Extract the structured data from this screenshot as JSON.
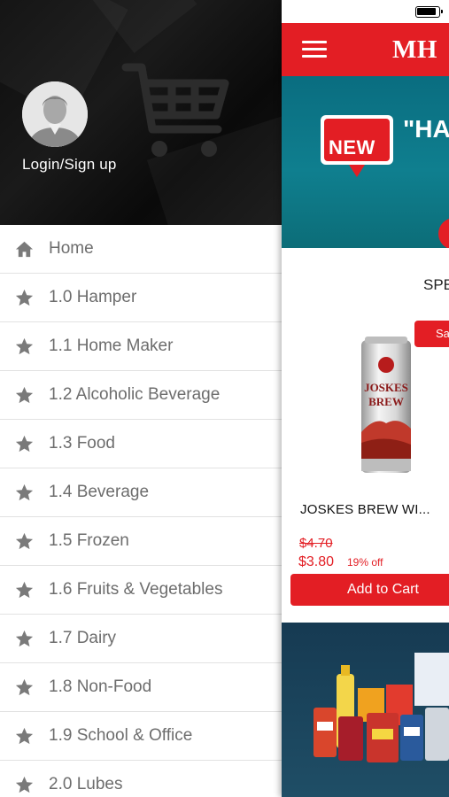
{
  "drawer": {
    "login_label": "Login/Sign up",
    "items": [
      {
        "label": "Home",
        "icon": "home-icon"
      },
      {
        "label": "1.0 Hamper",
        "icon": "star-icon"
      },
      {
        "label": "1.1 Home Maker",
        "icon": "star-icon"
      },
      {
        "label": "1.2 Alcoholic Beverage",
        "icon": "star-icon"
      },
      {
        "label": "1.3 Food",
        "icon": "star-icon"
      },
      {
        "label": "1.4 Beverage",
        "icon": "star-icon"
      },
      {
        "label": "1.5 Frozen",
        "icon": "star-icon"
      },
      {
        "label": "1.6 Fruits & Vegetables",
        "icon": "star-icon"
      },
      {
        "label": "1.7 Dairy",
        "icon": "star-icon"
      },
      {
        "label": "1.8 Non-Food",
        "icon": "star-icon"
      },
      {
        "label": "1.9 School & Office",
        "icon": "star-icon"
      },
      {
        "label": "2.0 Lubes",
        "icon": "star-icon"
      }
    ]
  },
  "app": {
    "brand": "MH",
    "banner": {
      "new_label": "NEW",
      "headline": "\"HAM"
    },
    "section_title": "SPE",
    "sale_badge": "Sa",
    "product": {
      "name": "JOSKES BREW WI...",
      "old_price": "$4.70",
      "price": "$3.80",
      "discount": "19% off",
      "add_to_cart": "Add to Cart"
    }
  },
  "colors": {
    "accent": "#e31e24",
    "drawer_header": "#111111",
    "banner": "#0f7f8f",
    "menu_text": "#6d6d6d",
    "icon": "#7a7a7a"
  }
}
